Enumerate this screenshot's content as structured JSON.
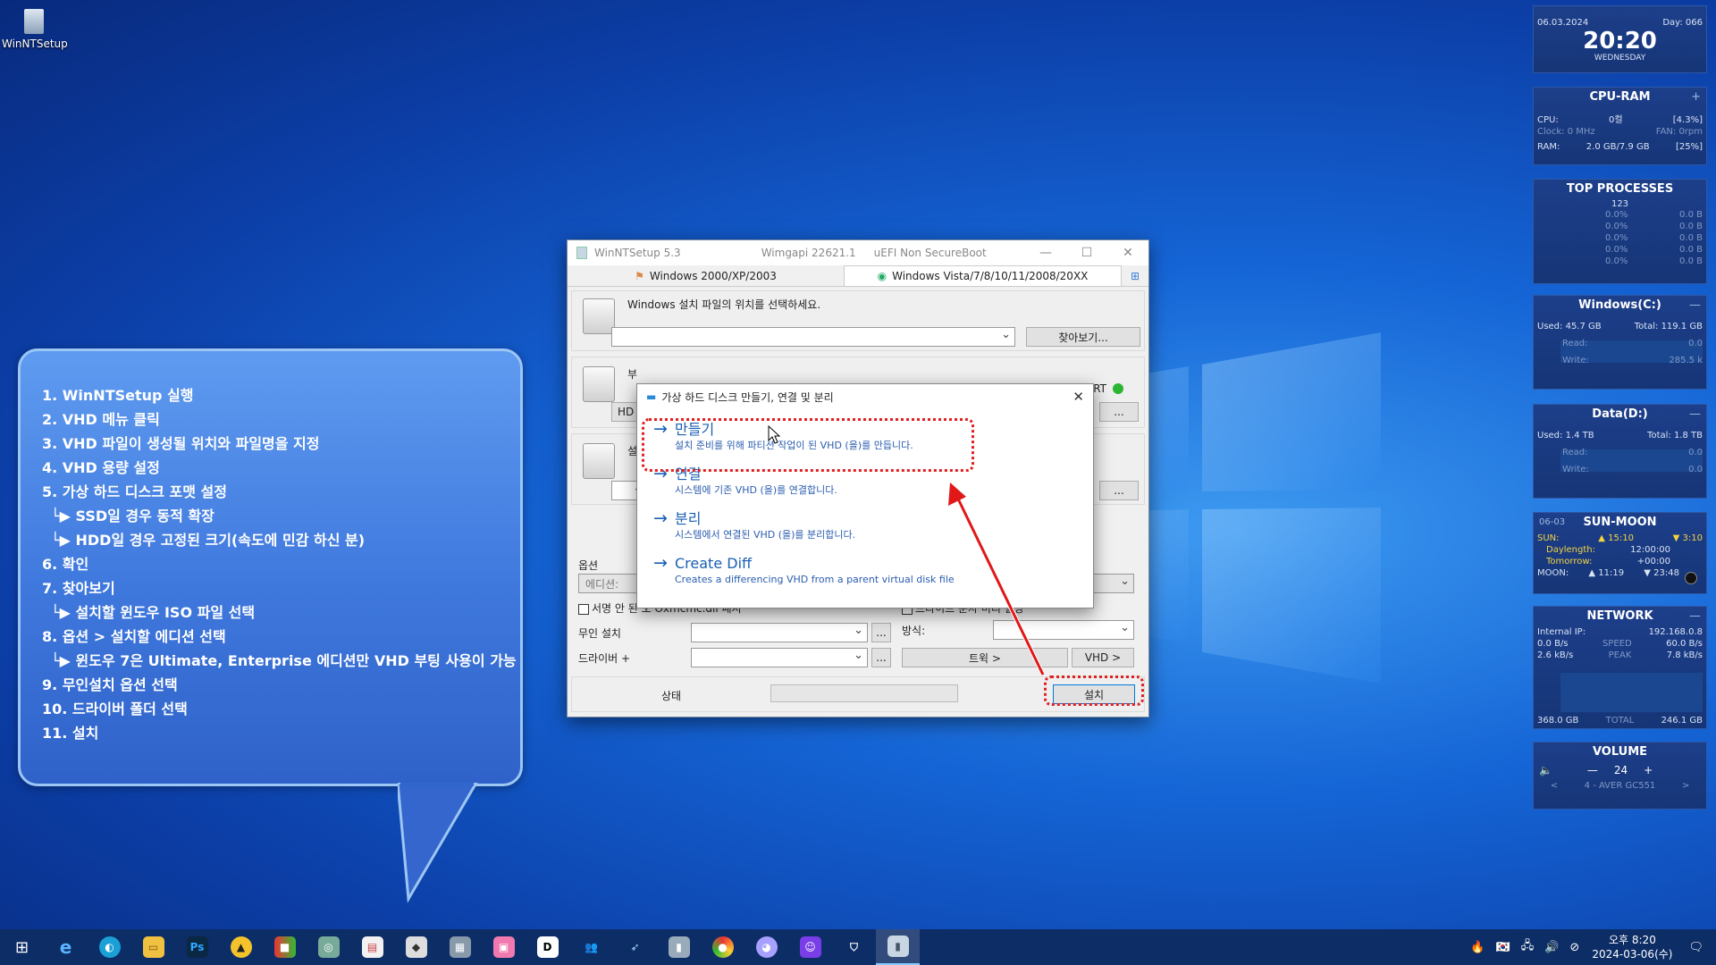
{
  "desktop": {
    "icon_label": "WinNTSetup"
  },
  "bubble": {
    "items": [
      {
        "text": "1. WinNTSetup 실행",
        "sub": false
      },
      {
        "text": "2. VHD 메뉴 클릭",
        "sub": false
      },
      {
        "text": "3. VHD 파일이 생성될 위치와 파일명을 지정",
        "sub": false
      },
      {
        "text": "4. VHD 용량 설정",
        "sub": false
      },
      {
        "text": "5. 가상 하드 디스크 포맷 설정",
        "sub": false
      },
      {
        "text": "└▶ SSD일 경우 동적 확장",
        "sub": true
      },
      {
        "text": "└▶ HDD일 경우 고정된 크기(속도에 민감 하신 분)",
        "sub": true
      },
      {
        "text": "6. 확인",
        "sub": false
      },
      {
        "text": "7. 찾아보기",
        "sub": false
      },
      {
        "text": "└▶ 설치할 윈도우 ISO 파일 선택",
        "sub": true
      },
      {
        "text": "8. 옵션 > 설치할 에디션 선택",
        "sub": false
      },
      {
        "text": "└▶ 윈도우 7은 Ultimate, Enterprise 에디션만 VHD 부팅 사용이 가능",
        "sub": true
      },
      {
        "text": "9. 무인설치 옵션 선택",
        "sub": false
      },
      {
        "text": "10. 드라이버 폴더 선택",
        "sub": false
      },
      {
        "text": "11. 설치",
        "sub": false
      }
    ]
  },
  "window": {
    "title": "WinNTSetup 5.3",
    "wimgapi": "Wimgapi 22621.1",
    "boot": "uEFI Non SecureBoot",
    "tabs": [
      "Windows 2000/XP/2003",
      "Windows Vista/7/8/10/11/2008/20XX"
    ],
    "source_label": "Windows 설치 파일의 위치를 선택하세요.",
    "browse": "찾아보기...",
    "frag": {
      "boot_cut": "부",
      "boot_hd": "HD",
      "install_cut": "설",
      "art": "ART",
      "dots": "..."
    },
    "options_label": "옵션",
    "edition_label": "에디션:",
    "checkbox1": "서명 안 된",
    "checkbox1_tail": "오 Oxmcmc.dll 패지",
    "checkbox2_tail": "드라이브 문자 미리 할당",
    "unattend_label": "무인 설치",
    "method_label": "방식:",
    "drivers_label": "드라이버 +",
    "tweaks": "트윅 >",
    "vhd": "VHD >",
    "status_label": "상태",
    "install": "설치",
    "colors": {
      "accent": "#1a5fb4",
      "highlight": "#e02020"
    }
  },
  "dialog": {
    "title": "가상 하드 디스크 만들기, 연결 및 분리",
    "options": [
      {
        "title": "만들기",
        "desc": "설치 준비를 위해 파티션 작업이 된 VHD (을)를 만듭니다."
      },
      {
        "title": "연결",
        "desc": "시스템에 기존 VHD (을)를 연결합니다."
      },
      {
        "title": "분리",
        "desc": "시스템에서 연결된 VHD (을)를 분리합니다."
      },
      {
        "title": "Create Diff",
        "desc": "Creates a differencing VHD from a parent virtual disk file"
      }
    ]
  },
  "widgets": {
    "clock": {
      "date": "06.03.2024",
      "day": "Day: 066",
      "time": "20:20",
      "weekday": "WEDNESDAY"
    },
    "cpu": {
      "title": "CPU-RAM",
      "cpu_label": "CPU:",
      "cpu_name": "0컬",
      "cpu_pct": "[4.3%]",
      "clock": "Clock: 0 MHz",
      "fan": "FAN: 0rpm",
      "ram_label": "RAM:",
      "ram_val": "2.0 GB/7.9 GB",
      "ram_pct": "[25%]"
    },
    "procs": {
      "title": "TOP PROCESSES",
      "count": "123",
      "rows": [
        [
          "0.0%",
          "0.0 B"
        ],
        [
          "0.0%",
          "0.0 B"
        ],
        [
          "0.0%",
          "0.0 B"
        ],
        [
          "0.0%",
          "0.0 B"
        ],
        [
          "0.0%",
          "0.0 B"
        ]
      ]
    },
    "diskc": {
      "title": "Windows(C:)",
      "used": "Used: 45.7 GB",
      "total": "Total: 119.1 GB",
      "read": "Read:",
      "read_v": "0.0",
      "write": "Write:",
      "write_v": "285.5 k"
    },
    "diskd": {
      "title": "Data(D:)",
      "used": "Used: 1.4 TB",
      "total": "Total: 1.8 TB",
      "read": "Read:",
      "read_v": "0.0",
      "write": "Write:",
      "write_v": "0.0"
    },
    "sun": {
      "title": "SUN-MOON",
      "date": "06-03",
      "sun": "SUN:",
      "rise": "▲ 15:10",
      "set": "▼ 3:10",
      "dl": "Daylength:",
      "dl_v": "12:00:00",
      "tm": "Tomorrow:",
      "tm_v": "+00:00",
      "moon": "MOON:",
      "mrise": "▲ 11:19",
      "mset": "▼ 23:48"
    },
    "net": {
      "title": "NETWORK",
      "ip_label": "Internal IP:",
      "ip": "192.168.0.8",
      "up": "0.0 B/s",
      "speed": "SPEED",
      "speed_v": "60.0 B/s",
      "down": "2.6 kB/s",
      "peak": "PEAK",
      "peak_v": "7.8 kB/s",
      "tot_l": "368.0 GB",
      "total": "TOTAL",
      "tot_r": "246.1 GB"
    },
    "vol": {
      "title": "VOLUME",
      "level": "24",
      "device": "4 - AVER GC551"
    }
  },
  "taskbar": {
    "time": "오후 8:20",
    "date": "2024-03-06(수)"
  }
}
